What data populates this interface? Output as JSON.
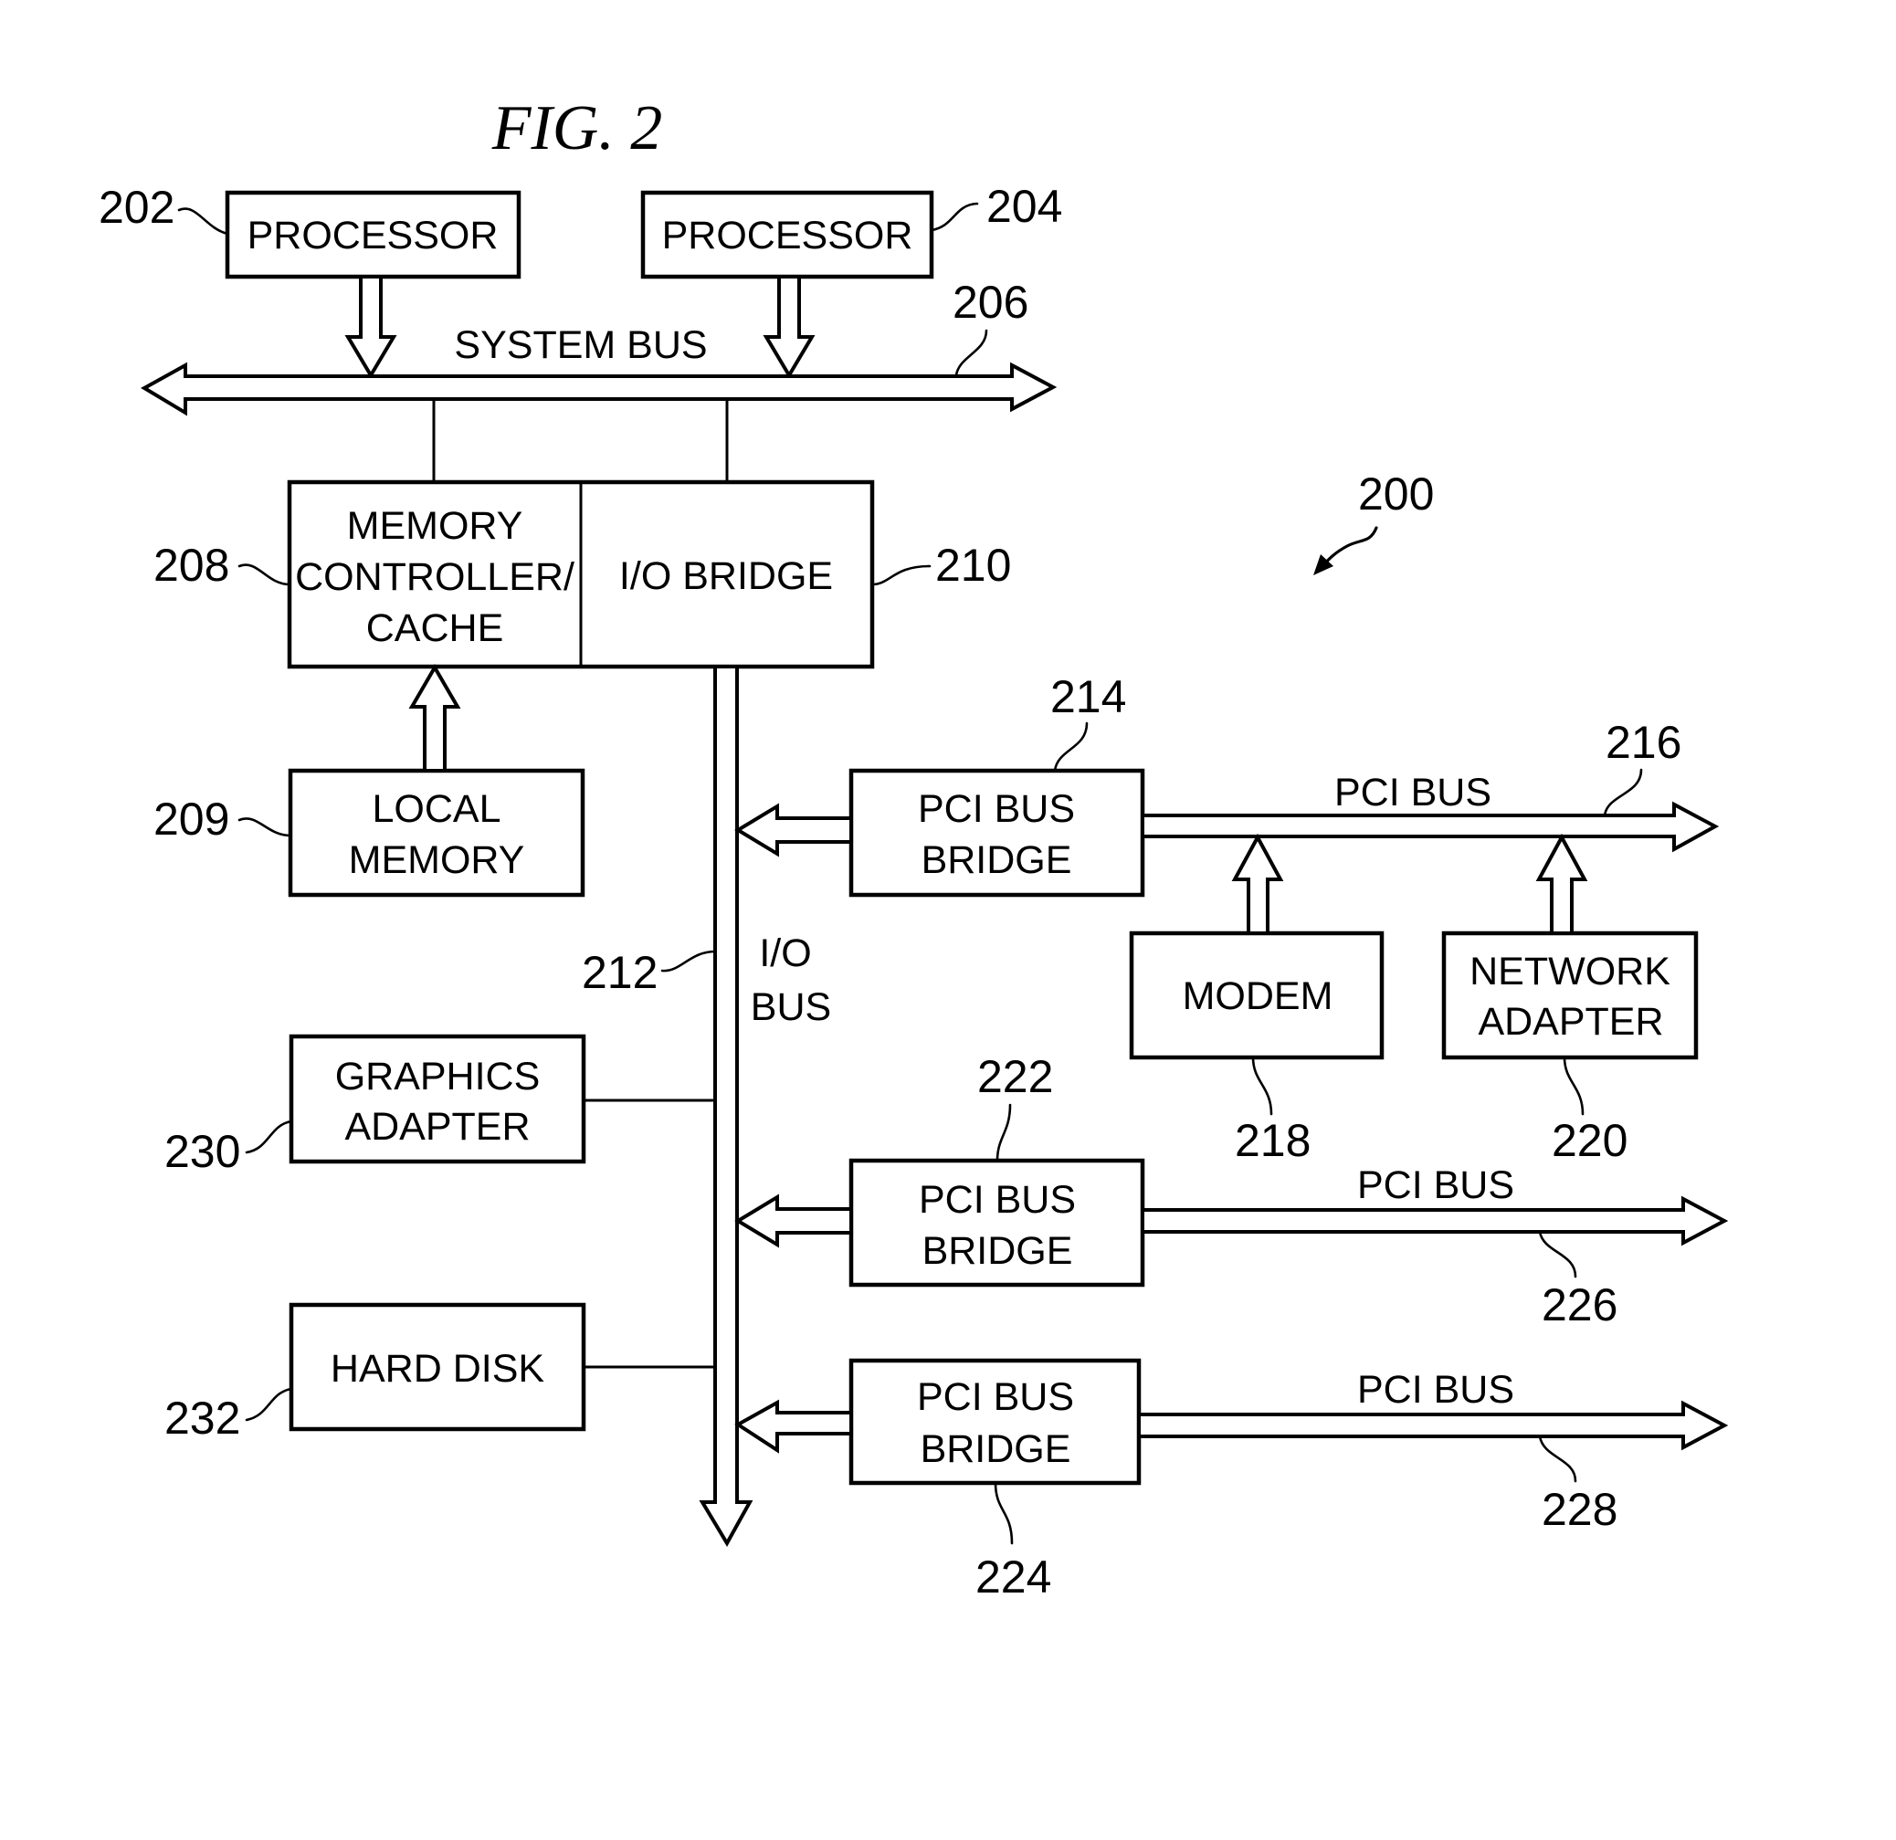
{
  "figure": {
    "title": "FIG. 2",
    "system_ref": "200"
  },
  "components": {
    "processor_1": {
      "label": "PROCESSOR",
      "ref": "202"
    },
    "processor_2": {
      "label": "PROCESSOR",
      "ref": "204"
    },
    "system_bus": {
      "label": "SYSTEM BUS",
      "ref": "206"
    },
    "memory_controller": {
      "lines": [
        "MEMORY",
        "CONTROLLER/",
        "CACHE"
      ],
      "ref": "208"
    },
    "local_memory": {
      "lines": [
        "LOCAL",
        "MEMORY"
      ],
      "ref": "209"
    },
    "io_bridge": {
      "label": "I/O BRIDGE",
      "ref": "210"
    },
    "io_bus": {
      "lines": [
        "I/O",
        "BUS"
      ],
      "ref": "212"
    },
    "pci_bridge_1": {
      "lines": [
        "PCI BUS",
        "BRIDGE"
      ],
      "ref": "214"
    },
    "pci_bus_1": {
      "label": "PCI BUS",
      "ref": "216"
    },
    "modem": {
      "label": "MODEM",
      "ref": "218"
    },
    "network_adapter": {
      "lines": [
        "NETWORK",
        "ADAPTER"
      ],
      "ref": "220"
    },
    "pci_bridge_2": {
      "lines": [
        "PCI BUS",
        "BRIDGE"
      ],
      "ref": "222"
    },
    "pci_bridge_3": {
      "lines": [
        "PCI BUS",
        "BRIDGE"
      ],
      "ref": "224"
    },
    "pci_bus_2": {
      "label": "PCI BUS",
      "ref": "226"
    },
    "pci_bus_3": {
      "label": "PCI BUS",
      "ref": "228"
    },
    "graphics_adapter": {
      "lines": [
        "GRAPHICS",
        "ADAPTER"
      ],
      "ref": "230"
    },
    "hard_disk": {
      "label": "HARD DISK",
      "ref": "232"
    }
  }
}
